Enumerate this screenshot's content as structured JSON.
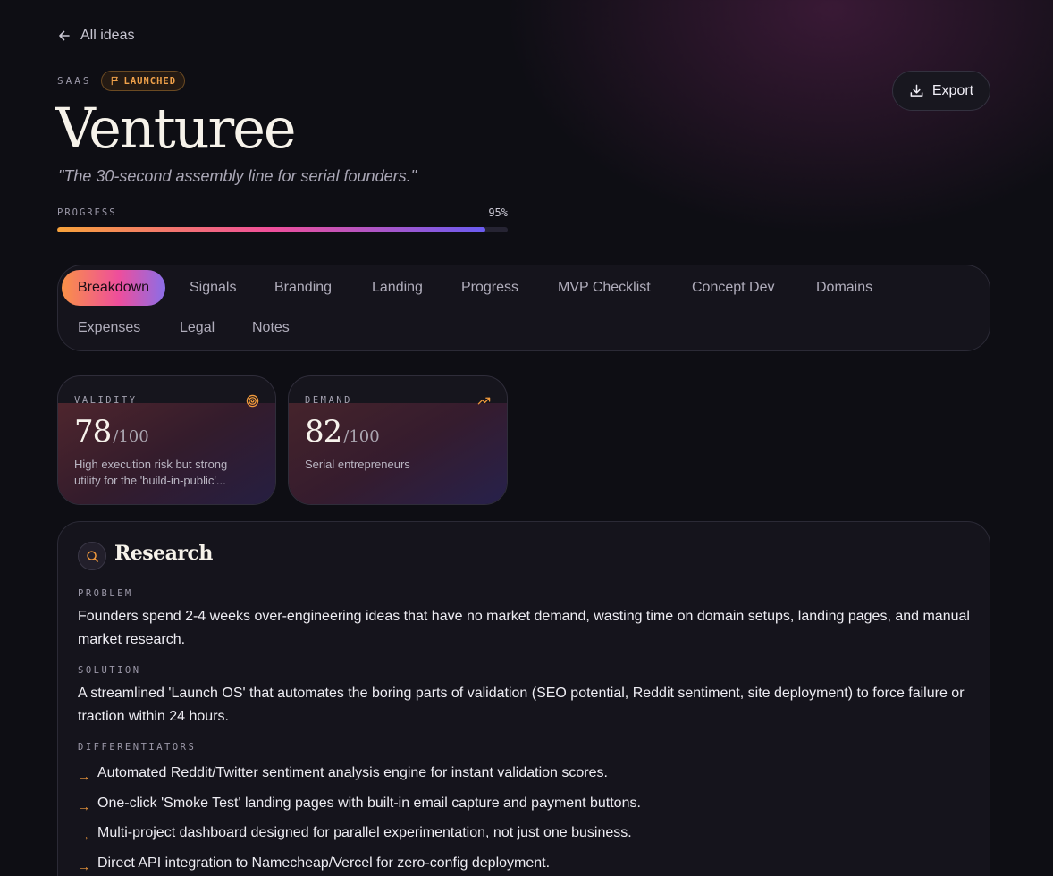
{
  "nav": {
    "back_label": "All ideas"
  },
  "header": {
    "category": "SAAS",
    "status": "LAUNCHED",
    "title": "Venturee",
    "tagline": "\"The 30-second assembly line for serial founders.\"",
    "progress_label": "PROGRESS",
    "progress_text": "95%",
    "progress_fraction": 0.95,
    "export_label": "Export"
  },
  "colors": {
    "accent_orange": "#f29a3c",
    "accent_pink": "#ee4e9c",
    "accent_violet": "#6a5cf2",
    "background": "#0e0e14"
  },
  "tabs": [
    {
      "label": "Breakdown",
      "active": true
    },
    {
      "label": "Signals",
      "active": false
    },
    {
      "label": "Branding",
      "active": false
    },
    {
      "label": "Landing",
      "active": false
    },
    {
      "label": "Progress",
      "active": false
    },
    {
      "label": "MVP Checklist",
      "active": false
    },
    {
      "label": "Concept Dev",
      "active": false
    },
    {
      "label": "Domains",
      "active": false
    },
    {
      "label": "Expenses",
      "active": false
    },
    {
      "label": "Legal",
      "active": false
    },
    {
      "label": "Notes",
      "active": false
    }
  ],
  "metrics": [
    {
      "label": "VALIDITY",
      "icon": "target-icon",
      "score": "78",
      "max": "/100",
      "description": "High execution risk but strong utility for the 'build-in-public'..."
    },
    {
      "label": "DEMAND",
      "icon": "trending-up-icon",
      "score": "82",
      "max": "/100",
      "description": "Serial entrepreneurs"
    }
  ],
  "research": {
    "title": "Research",
    "icon": "search-icon",
    "problem_label": "PROBLEM",
    "problem_text": "Founders spend 2-4 weeks over-engineering ideas that have no market demand, wasting time on domain setups, landing pages, and manual market research.",
    "solution_label": "SOLUTION",
    "solution_text": "A streamlined 'Launch OS' that automates the boring parts of validation (SEO potential, Reddit sentiment, site deployment) to force failure or traction within 24 hours.",
    "differentiators_label": "DIFFERENTIATORS",
    "differentiator_arrow": "→",
    "differentiators": [
      "Automated Reddit/Twitter sentiment analysis engine for instant validation scores.",
      "One-click 'Smoke Test' landing pages with built-in email capture and payment buttons.",
      "Multi-project dashboard designed for parallel experimentation, not just one business.",
      "Direct API integration to Namecheap/Vercel for zero-config deployment."
    ]
  }
}
